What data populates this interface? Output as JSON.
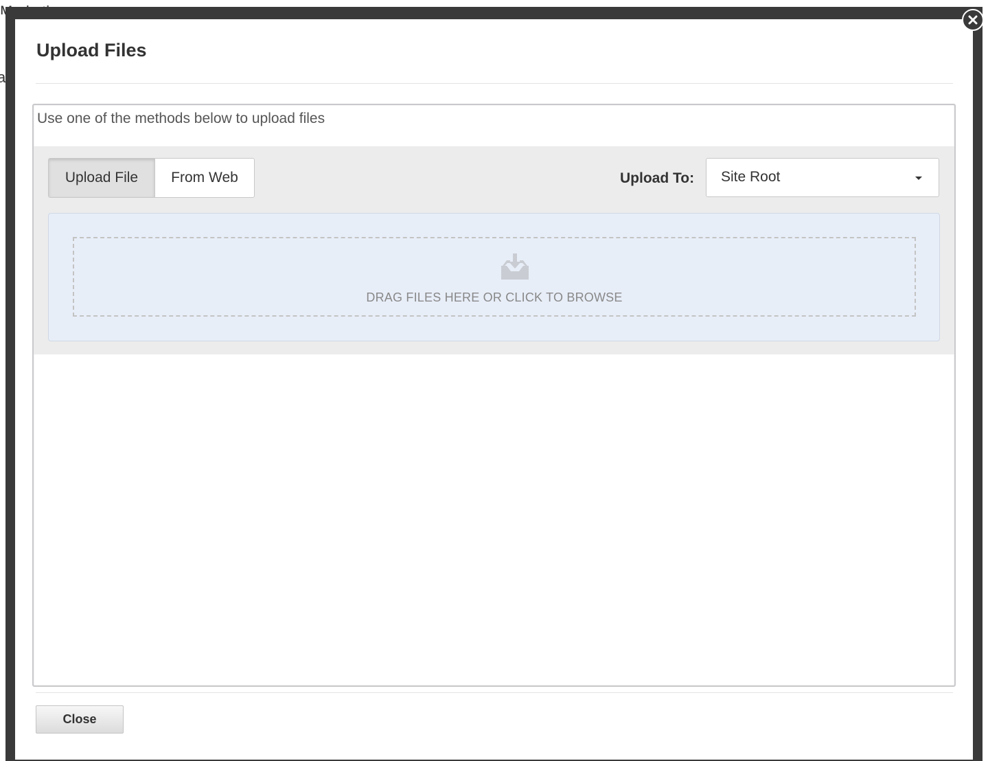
{
  "background": {
    "text_top": "Marketing",
    "text_left": "a"
  },
  "modal": {
    "title": "Upload Files",
    "intro": "Use one of the methods below to upload files",
    "tabs": [
      {
        "label": "Upload File",
        "active": true
      },
      {
        "label": "From Web",
        "active": false
      }
    ],
    "upload_to_label": "Upload To:",
    "upload_to_value": "Site Root",
    "dropzone_text": "DRAG FILES HERE OR CLICK TO BROWSE",
    "close_button": "Close",
    "close_icon": "close-circle-icon"
  },
  "colors": {
    "overlay": "#3a3a3a",
    "dropzone_bg": "#e8eef8",
    "toolbar_bg": "#ececec"
  }
}
